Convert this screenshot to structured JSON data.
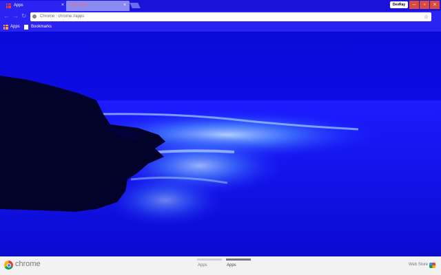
{
  "tabs": [
    {
      "label": "Apps",
      "active": true
    },
    {
      "label": "New Tab",
      "active": false
    }
  ],
  "window": {
    "profile_label": "DevRay"
  },
  "omnibox": {
    "label": "Chrome",
    "url": "chrome://apps"
  },
  "bookmarks": [
    {
      "label": "Apps",
      "icon": "apps-grid-icon"
    },
    {
      "label": "Bookmarks",
      "icon": "folder-icon"
    }
  ],
  "bottom_bar": {
    "brand": "chrome",
    "pages": [
      {
        "label": "Apps",
        "active": false
      },
      {
        "label": "Apps",
        "active": true
      }
    ],
    "web_store": "Web Store"
  },
  "colors": {
    "accent": "#2a23f2",
    "background_blue": "#0e0ee8"
  }
}
